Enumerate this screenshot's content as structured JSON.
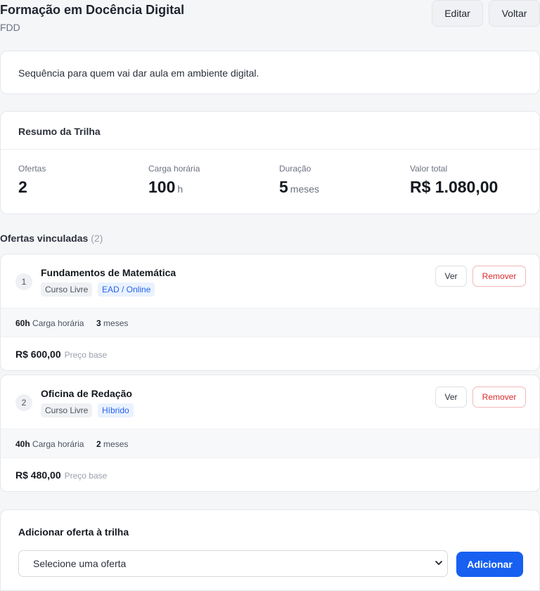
{
  "header": {
    "title": "Formação em Docência Digital",
    "code": "FDD",
    "edit_label": "Editar",
    "back_label": "Voltar"
  },
  "description": "Sequência para quem vai dar aula em ambiente digital.",
  "summary": {
    "title": "Resumo da Trilha",
    "stats": [
      {
        "label": "Ofertas",
        "value": "2",
        "unit": ""
      },
      {
        "label": "Carga horária",
        "value": "100",
        "unit": "h"
      },
      {
        "label": "Duração",
        "value": "5",
        "unit": "meses"
      },
      {
        "label": "Valor total",
        "value": "R$ 1.080,00",
        "unit": ""
      }
    ]
  },
  "offers_section": {
    "title": "Ofertas vinculadas",
    "count": "(2)"
  },
  "offers": [
    {
      "number": "1",
      "name": "Fundamentos de Matemática",
      "type_tag": "Curso Livre",
      "modality_tag": "EAD / Online",
      "hours": "60h",
      "hours_label": "Carga horária",
      "duration": "3",
      "duration_label": "meses",
      "price": "R$ 600,00",
      "price_label": "Preço base",
      "view_label": "Ver",
      "remove_label": "Remover"
    },
    {
      "number": "2",
      "name": "Oficina de Redação",
      "type_tag": "Curso Livre",
      "modality_tag": "Híbrido",
      "hours": "40h",
      "hours_label": "Carga horária",
      "duration": "2",
      "duration_label": "meses",
      "price": "R$ 480,00",
      "price_label": "Preço base",
      "view_label": "Ver",
      "remove_label": "Remover"
    }
  ],
  "add_offer": {
    "title": "Adicionar oferta à trilha",
    "select_value": "Selecione uma oferta",
    "add_label": "Adicionar"
  },
  "colors": {
    "primary": "#1760f0",
    "danger": "#d92d2d",
    "tag_blue": "#2563eb"
  }
}
